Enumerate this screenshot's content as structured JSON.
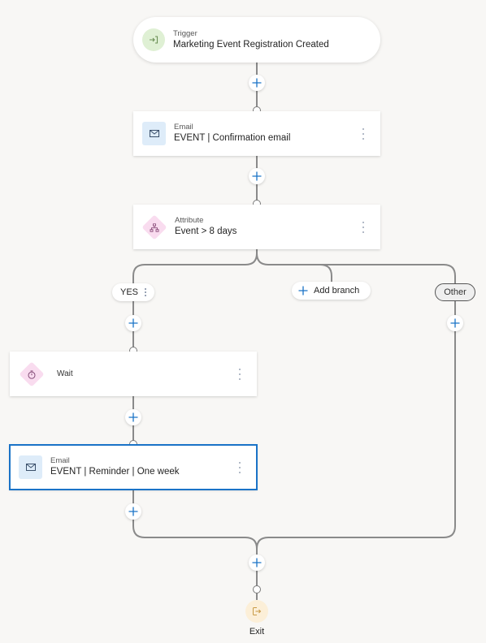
{
  "trigger": {
    "kind": "Trigger",
    "title": "Marketing Event Registration Created",
    "icon": "trigger-enter-icon"
  },
  "steps": [
    {
      "kind": "Email",
      "title": "EVENT | Confirmation email",
      "icon": "mail-icon"
    },
    {
      "kind": "Attribute",
      "title": "Event > 8 days",
      "icon": "branch-hierarchy-icon"
    }
  ],
  "branches": {
    "yes": {
      "label": "YES"
    },
    "add_branch": {
      "label": "Add branch"
    },
    "other": {
      "label": "Other"
    }
  },
  "yes_branch_steps": [
    {
      "kind": "",
      "title": "Wait",
      "icon": "timer-icon"
    },
    {
      "kind": "Email",
      "title": "EVENT | Reminder | One week",
      "icon": "mail-icon",
      "selected": true
    }
  ],
  "exit": {
    "label": "Exit",
    "icon": "exit-icon"
  },
  "colors": {
    "accent": "#1a73c7",
    "connector": "#8a8a8a",
    "trigger_bg": "#dff0d4",
    "email_bg": "#deecf9",
    "attribute_bg": "#f9dcef",
    "exit_bg": "#fcefd8"
  }
}
